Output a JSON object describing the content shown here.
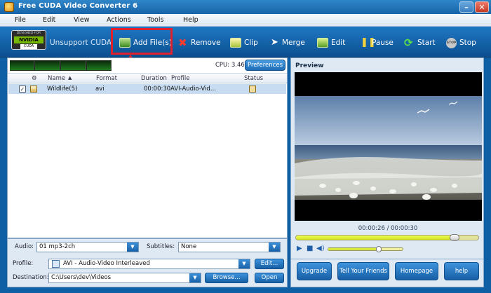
{
  "window": {
    "title": "Free CUDA Video Converter 6"
  },
  "menu": [
    "File",
    "Edit",
    "View",
    "Actions",
    "Tools",
    "Help"
  ],
  "toolbar": {
    "nvidia_badge": {
      "line1": "DESIGNED FOR",
      "line2": "NVIDIA",
      "line3": "CUDA"
    },
    "cuda_status": "Unsupport CUDA",
    "add_files": "Add File(s)",
    "remove": "Remove",
    "clip": "Clip",
    "merge": "Merge",
    "edit": "Edit",
    "pause": "Pause",
    "start": "Start",
    "stop": "Stop",
    "stop_icon_text": "STOP"
  },
  "file_list": {
    "cpu_label": "CPU: 3.46%",
    "preferences": "Preferences",
    "columns": {
      "name": "Name",
      "format": "Format",
      "duration": "Duration",
      "profile": "Profile",
      "status": "Status"
    },
    "rows": [
      {
        "checked": true,
        "checkmark": "✓",
        "name": "Wildlife(5)",
        "format": "avi",
        "duration": "00:00:30",
        "profile": "AVI-Audio-Vid..."
      }
    ]
  },
  "audio": {
    "label": "Audio:",
    "value": "01 mp3-2ch"
  },
  "subtitles": {
    "label": "Subtitles:",
    "value": "None"
  },
  "profile": {
    "label": "Profile:",
    "value": "AVI - Audio-Video Interleaved",
    "edit_button": "Edit..."
  },
  "destination": {
    "label": "Destination:",
    "value": "C:\\Users\\dev\\Videos",
    "browse_button": "Browse...",
    "open_button": "Open"
  },
  "preview": {
    "title": "Preview",
    "time": "00:00:26 / 00:00:30",
    "progress": 0.87,
    "volume": 0.68
  },
  "links": [
    "Upgrade",
    "Tell Your Friends",
    "Homepage",
    "help"
  ],
  "colors": {
    "accent": "#1763a8",
    "highlight": "#e0202a"
  }
}
